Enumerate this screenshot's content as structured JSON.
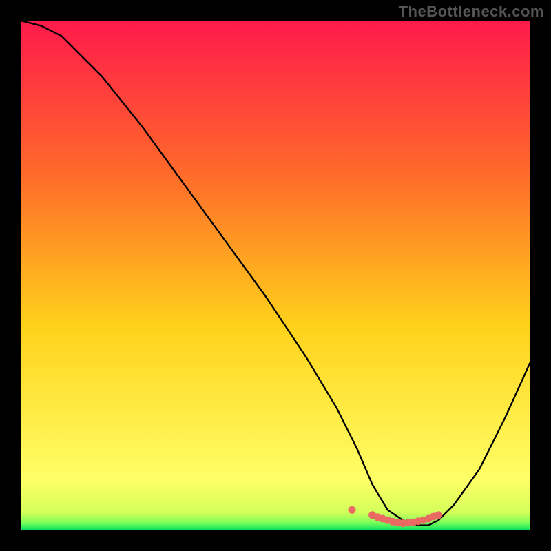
{
  "watermark": "TheBottleneck.com",
  "colors": {
    "gradient_top": "#ff1a4b",
    "gradient_mid1": "#ff6a2a",
    "gradient_mid2": "#ffd21a",
    "gradient_mid3": "#ffff66",
    "gradient_bottom": "#00e060",
    "curve": "#000000",
    "marker": "#e96a63"
  },
  "chart_data": {
    "type": "line",
    "title": "",
    "xlabel": "",
    "ylabel": "",
    "xlim": [
      0,
      100
    ],
    "ylim": [
      0,
      100
    ],
    "grid": false,
    "series": [
      {
        "name": "bottleneck-curve",
        "x": [
          0,
          4,
          8,
          16,
          24,
          32,
          40,
          48,
          56,
          62,
          66,
          69,
          72,
          75,
          78,
          80,
          82,
          85,
          90,
          95,
          100
        ],
        "values": [
          100,
          99,
          97,
          89,
          79,
          68,
          57,
          46,
          34,
          24,
          16,
          9,
          4,
          2,
          1,
          1,
          2,
          5,
          12,
          22,
          33
        ]
      }
    ],
    "markers": {
      "name": "highlight-points",
      "x": [
        65,
        69,
        70,
        71,
        72,
        73,
        74,
        75,
        76,
        77,
        78,
        79,
        80,
        81,
        82
      ],
      "values": [
        4.0,
        3.0,
        2.6,
        2.3,
        2.0,
        1.7,
        1.5,
        1.4,
        1.5,
        1.6,
        1.8,
        2.0,
        2.3,
        2.7,
        3.0
      ]
    }
  }
}
